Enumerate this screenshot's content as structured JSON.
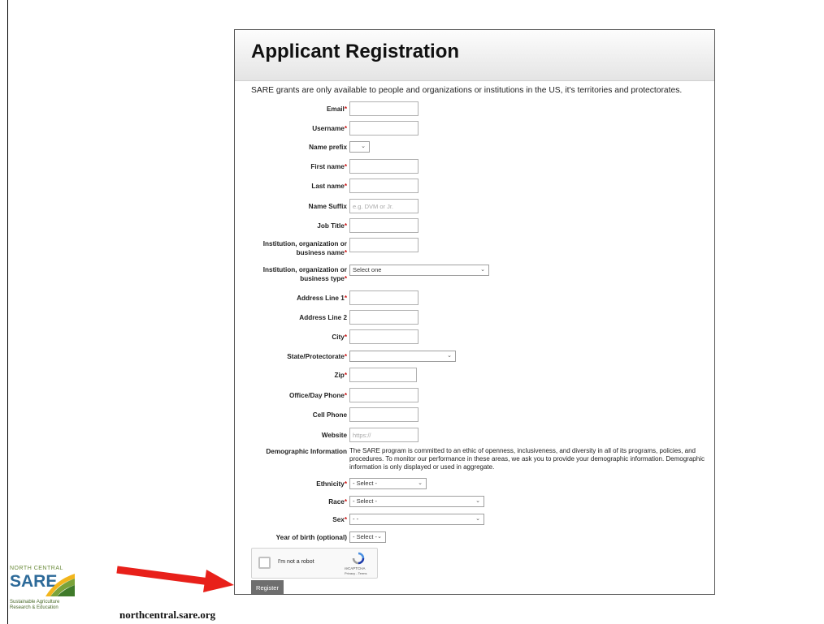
{
  "form": {
    "title": "Applicant Registration",
    "intro": "SARE grants are only available to people and organizations or institutions in the US, it's territories and protectorates.",
    "fields": {
      "email": {
        "label": "Email",
        "required": "*"
      },
      "username": {
        "label": "Username",
        "required": "*"
      },
      "name_prefix": {
        "label": "Name prefix",
        "value": ""
      },
      "first_name": {
        "label": "First name",
        "required": "*"
      },
      "last_name": {
        "label": "Last name",
        "required": "*"
      },
      "name_suffix": {
        "label": "Name Suffix",
        "placeholder": "e.g. DVM or Jr."
      },
      "job_title": {
        "label": "Job Title",
        "required": "*"
      },
      "institution_name": {
        "label_line1": "Institution, organization or",
        "label_line2": "business name",
        "required": "*"
      },
      "institution_type": {
        "label_line1": "Institution, organization or",
        "label_line2": "business type",
        "required": "*",
        "value": "Select one"
      },
      "address1": {
        "label": "Address Line 1",
        "required": "*"
      },
      "address2": {
        "label": "Address Line 2"
      },
      "city": {
        "label": "City",
        "required": "*"
      },
      "state": {
        "label": "State/Protectorate",
        "required": "*",
        "value": ""
      },
      "zip": {
        "label": "Zip",
        "required": "*"
      },
      "office_phone": {
        "label": "Office/Day Phone",
        "required": "*"
      },
      "cell_phone": {
        "label": "Cell Phone"
      },
      "website": {
        "label": "Website",
        "placeholder": "https://"
      },
      "demographic": {
        "label": "Demographic Information",
        "text": "The SARE program is committed to an ethic of openness, inclusiveness, and diversity in all of its programs, policies, and procedures. To monitor our performance in these areas, we ask you to provide your demographic information. Demographic information is only displayed or used in aggregate."
      },
      "ethnicity": {
        "label": "Ethnicity",
        "required": "*",
        "value": "- Select -"
      },
      "race": {
        "label": "Race",
        "required": "*",
        "value": "- Select -"
      },
      "sex": {
        "label": "Sex",
        "required": "*",
        "value": "- -"
      },
      "birth_year": {
        "label": "Year of birth (optional)",
        "value": "- Select -"
      }
    },
    "captcha": {
      "label": "I'm not a robot",
      "brand": "reCAPTCHA",
      "links": "Privacy - Terms"
    },
    "register_label": "Register"
  },
  "slide": {
    "site_url": "northcentral.sare.org",
    "logo": {
      "top": "NORTH CENTRAL",
      "main": "SARE",
      "sub_line1": "Sustainable Agriculture",
      "sub_line2": "Research & Education"
    },
    "arrow_color": "#e8201a"
  }
}
